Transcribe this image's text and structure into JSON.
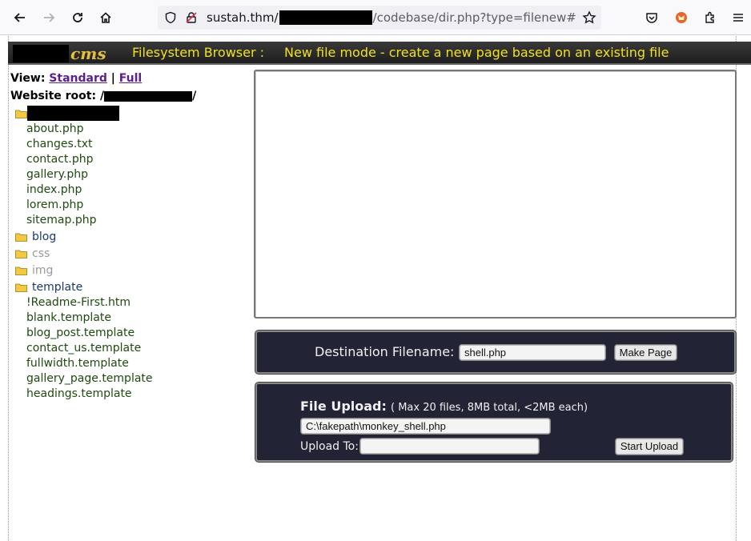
{
  "browser": {
    "url_host": "sustah.thm/",
    "url_path": "/codebase/dir.php?type=filenew#"
  },
  "header": {
    "logo_suffix": "cms",
    "title": "Filesystem Browser :",
    "mode": "New file mode - create a new page based on an existing file"
  },
  "view": {
    "label": "View:",
    "standard": "Standard",
    "separator": "|",
    "full": "Full"
  },
  "root": {
    "label": "Website root: /",
    "suffix": "/"
  },
  "tree": {
    "root_files": [
      "about.php",
      "changes.txt",
      "contact.php",
      "gallery.php",
      "index.php",
      "lorem.php",
      "sitemap.php"
    ],
    "folders": [
      {
        "name": "blog",
        "state": "active"
      },
      {
        "name": "css",
        "state": "muted"
      },
      {
        "name": "img",
        "state": "muted"
      },
      {
        "name": "template",
        "state": "active"
      }
    ],
    "template_files": [
      "!Readme-First.htm",
      "blank.template",
      "blog_post.template",
      "contact_us.template",
      "fullwidth.template",
      "gallery_page.template",
      "headings.template"
    ]
  },
  "destination": {
    "label": "Destination Filename:",
    "value": "shell.php",
    "button": "Make Page"
  },
  "upload": {
    "title": "File Upload:",
    "limits": "( Max 20 files, 8MB total, <2MB each)",
    "file_value": "C:\\fakepath\\monkey_shell.php",
    "upload_to_label": "Upload To:",
    "upload_to_value": "",
    "button": "Start Upload"
  },
  "colors": {
    "header_text": "#f0e020",
    "panel_bg": "#232336",
    "file_text": "#1f4a10",
    "folder_active": "#1b3a6b",
    "folder_muted": "#9a9a9a"
  }
}
